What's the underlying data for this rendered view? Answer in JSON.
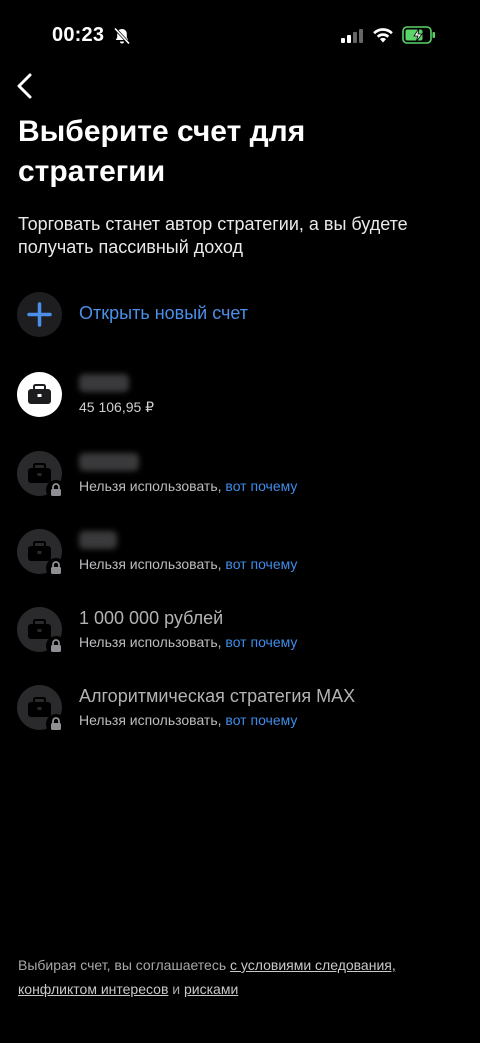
{
  "status_bar": {
    "time": "00:23"
  },
  "header": {
    "title": "Выберите счет для стратегии",
    "subtitle": "Торговать станет автор стратегии, а вы будете получать пассивный доход"
  },
  "open_account": {
    "label": "Открыть новый счет"
  },
  "accounts": [
    {
      "name": "",
      "balance": "45 106,95 ₽",
      "available": true
    },
    {
      "name": "",
      "status": "Нельзя использовать,",
      "why": "вот почему",
      "available": false
    },
    {
      "name": "",
      "status": "Нельзя использовать,",
      "why": "вот почему",
      "available": false
    },
    {
      "name": "1 000 000 рублей",
      "status": "Нельзя использовать,",
      "why": "вот почему",
      "available": false
    },
    {
      "name": "Алгоритмическая стратегия MAX",
      "status": "Нельзя использовать,",
      "why": "вот почему",
      "available": false
    }
  ],
  "footer": {
    "prefix": "Выбирая счет, вы соглашаетесь",
    "link1": "с условиями следования,",
    "link2": "конфликтом интересов",
    "middle": "и",
    "link3": "рисками"
  },
  "colors": {
    "accent": "#3f8ce8",
    "background": "#000000"
  }
}
